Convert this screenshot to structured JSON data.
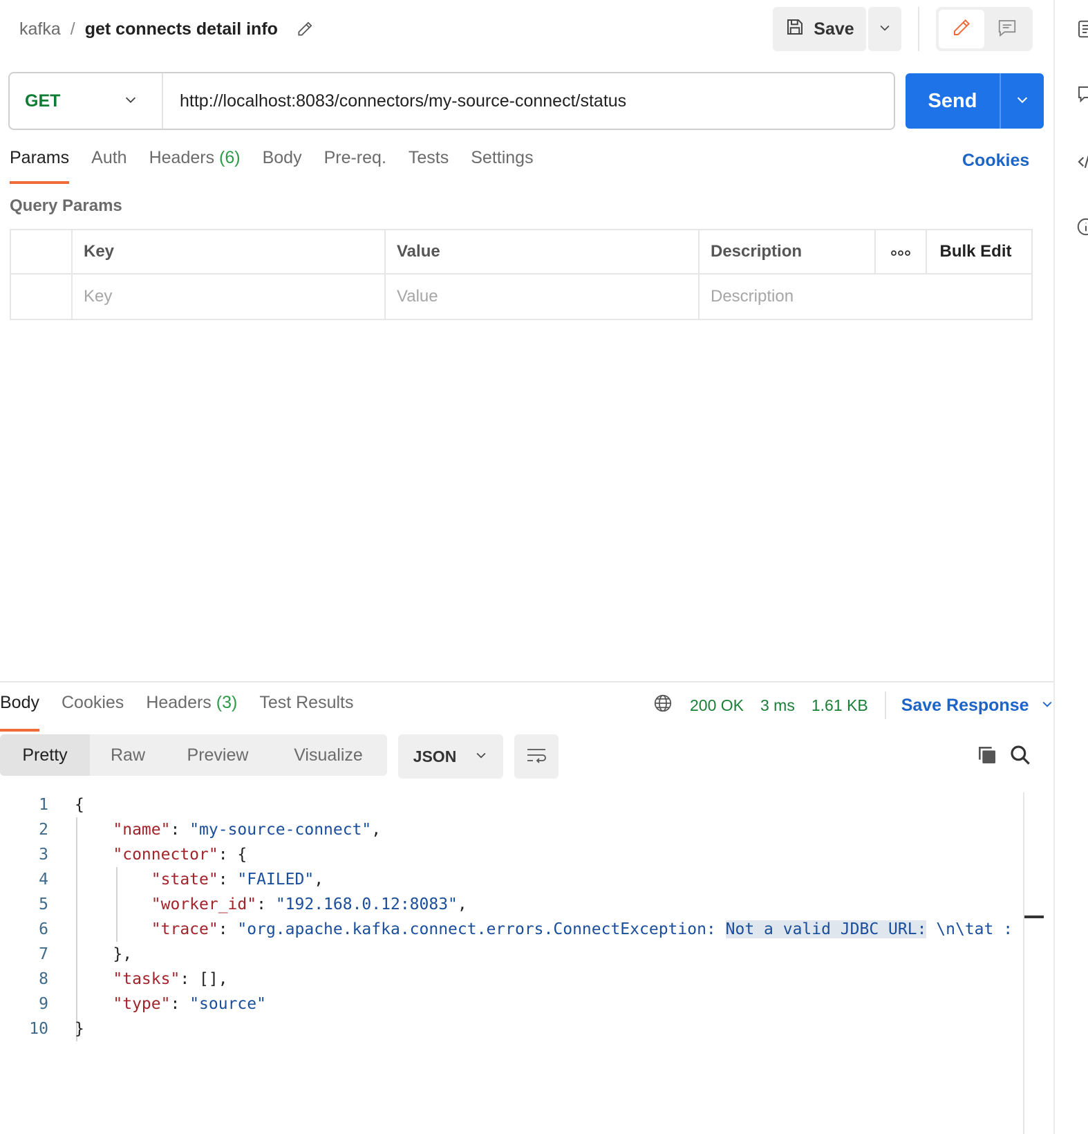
{
  "header": {
    "collection": "kafka",
    "separator": "/",
    "request_name": "get connects detail info",
    "save_label": "Save"
  },
  "request": {
    "method": "GET",
    "url": "http://localhost:8083/connectors/my-source-connect/status",
    "send_label": "Send"
  },
  "request_tabs": [
    {
      "label": "Params",
      "count": ""
    },
    {
      "label": "Auth",
      "count": ""
    },
    {
      "label": "Headers",
      "count": "(6)"
    },
    {
      "label": "Body",
      "count": ""
    },
    {
      "label": "Pre-req.",
      "count": ""
    },
    {
      "label": "Tests",
      "count": ""
    },
    {
      "label": "Settings",
      "count": ""
    }
  ],
  "cookies_label": "Cookies",
  "query_params": {
    "title": "Query Params",
    "headers": {
      "key": "Key",
      "value": "Value",
      "description": "Description",
      "bulk_edit": "Bulk Edit"
    },
    "placeholders": {
      "key": "Key",
      "value": "Value",
      "description": "Description"
    }
  },
  "response_tabs": [
    {
      "label": "Body",
      "count": ""
    },
    {
      "label": "Cookies",
      "count": ""
    },
    {
      "label": "Headers",
      "count": "(3)"
    },
    {
      "label": "Test Results",
      "count": ""
    }
  ],
  "response_meta": {
    "status": "200 OK",
    "time": "3 ms",
    "size": "1.61 KB",
    "save_response_label": "Save Response"
  },
  "view_modes": [
    "Pretty",
    "Raw",
    "Preview",
    "Visualize"
  ],
  "format": "JSON",
  "code_lines": [
    {
      "n": "1",
      "parts": [
        [
          "p",
          "{"
        ]
      ]
    },
    {
      "n": "2",
      "parts": [
        [
          "p",
          "    "
        ],
        [
          "k",
          "\"name\""
        ],
        [
          "p",
          ": "
        ],
        [
          "s",
          "\"my-source-connect\""
        ],
        [
          "p",
          ","
        ]
      ]
    },
    {
      "n": "3",
      "parts": [
        [
          "p",
          "    "
        ],
        [
          "k",
          "\"connector\""
        ],
        [
          "p",
          ": {"
        ]
      ]
    },
    {
      "n": "4",
      "parts": [
        [
          "p",
          "        "
        ],
        [
          "k",
          "\"state\""
        ],
        [
          "p",
          ": "
        ],
        [
          "s",
          "\"FAILED\""
        ],
        [
          "p",
          ","
        ]
      ]
    },
    {
      "n": "5",
      "parts": [
        [
          "p",
          "        "
        ],
        [
          "k",
          "\"worker_id\""
        ],
        [
          "p",
          ": "
        ],
        [
          "s",
          "\"192.168.0.12:8083\""
        ],
        [
          "p",
          ","
        ]
      ]
    },
    {
      "n": "6",
      "parts": [
        [
          "p",
          "        "
        ],
        [
          "k",
          "\"trace\""
        ],
        [
          "p",
          ": "
        ],
        [
          "s",
          "\"org.apache.kafka.connect.errors.ConnectException: "
        ],
        [
          "sh",
          "Not a valid JDBC URL:"
        ],
        [
          "s",
          " \\n\\tat :"
        ]
      ]
    },
    {
      "n": "7",
      "parts": [
        [
          "p",
          "    },"
        ]
      ]
    },
    {
      "n": "8",
      "parts": [
        [
          "p",
          "    "
        ],
        [
          "k",
          "\"tasks\""
        ],
        [
          "p",
          ": [],"
        ]
      ]
    },
    {
      "n": "9",
      "parts": [
        [
          "p",
          "    "
        ],
        [
          "k",
          "\"type\""
        ],
        [
          "p",
          ": "
        ],
        [
          "s",
          "\"source\""
        ]
      ]
    },
    {
      "n": "10",
      "parts": [
        [
          "p",
          "}"
        ]
      ]
    }
  ],
  "colors": {
    "accent": "#ef6c3a",
    "primary": "#1f73e8",
    "success": "#1a7f37",
    "json_key": "#a3232b",
    "json_string": "#1a4e9b"
  },
  "icons": [
    "pencil-icon",
    "save-icon",
    "chevron-down-icon",
    "comment-icon",
    "globe-icon",
    "copy-icon",
    "search-icon",
    "wrap-lines-icon",
    "more-icon"
  ]
}
